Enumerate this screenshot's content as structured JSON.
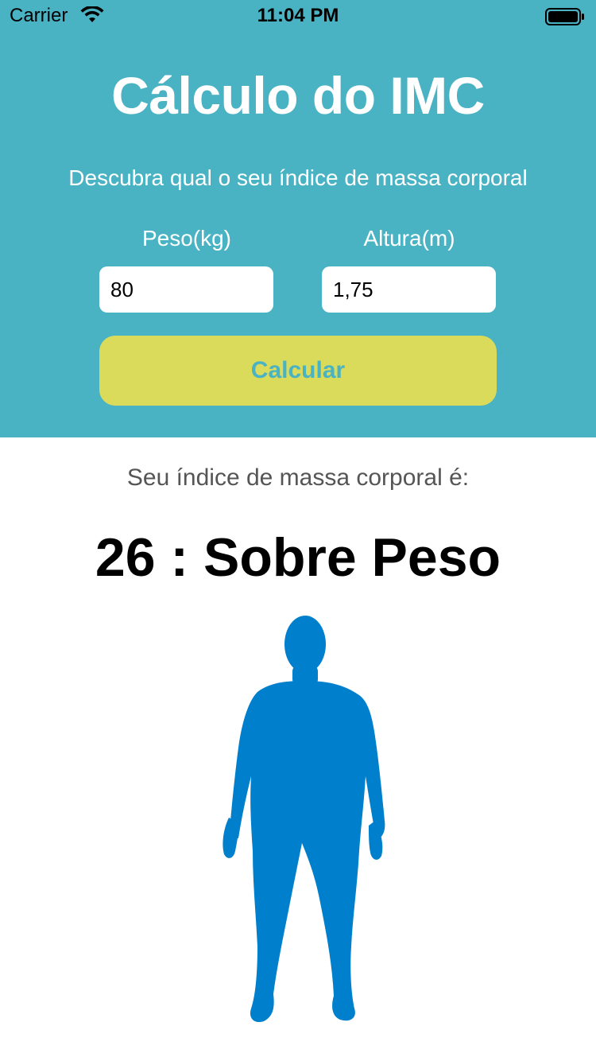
{
  "status_bar": {
    "carrier": "Carrier",
    "time": "11:04 PM",
    "wifi_icon": "wifi-icon",
    "battery_icon": "battery-icon"
  },
  "header": {
    "title": "Cálculo do IMC",
    "subtitle": "Descubra qual o seu índice de massa corporal",
    "background_color": "#4ab3c3"
  },
  "form": {
    "peso_label": "Peso(kg)",
    "peso_value": "80",
    "altura_label": "Altura(m)",
    "altura_value": "1,75",
    "calc_button_label": "Calcular",
    "button_color": "#dbdb5b"
  },
  "result": {
    "caption": "Seu índice de massa corporal é:",
    "value": "26 : Sobre Peso",
    "figure_icon": "body-silhouette-icon",
    "figure_color": "#0080cc"
  }
}
